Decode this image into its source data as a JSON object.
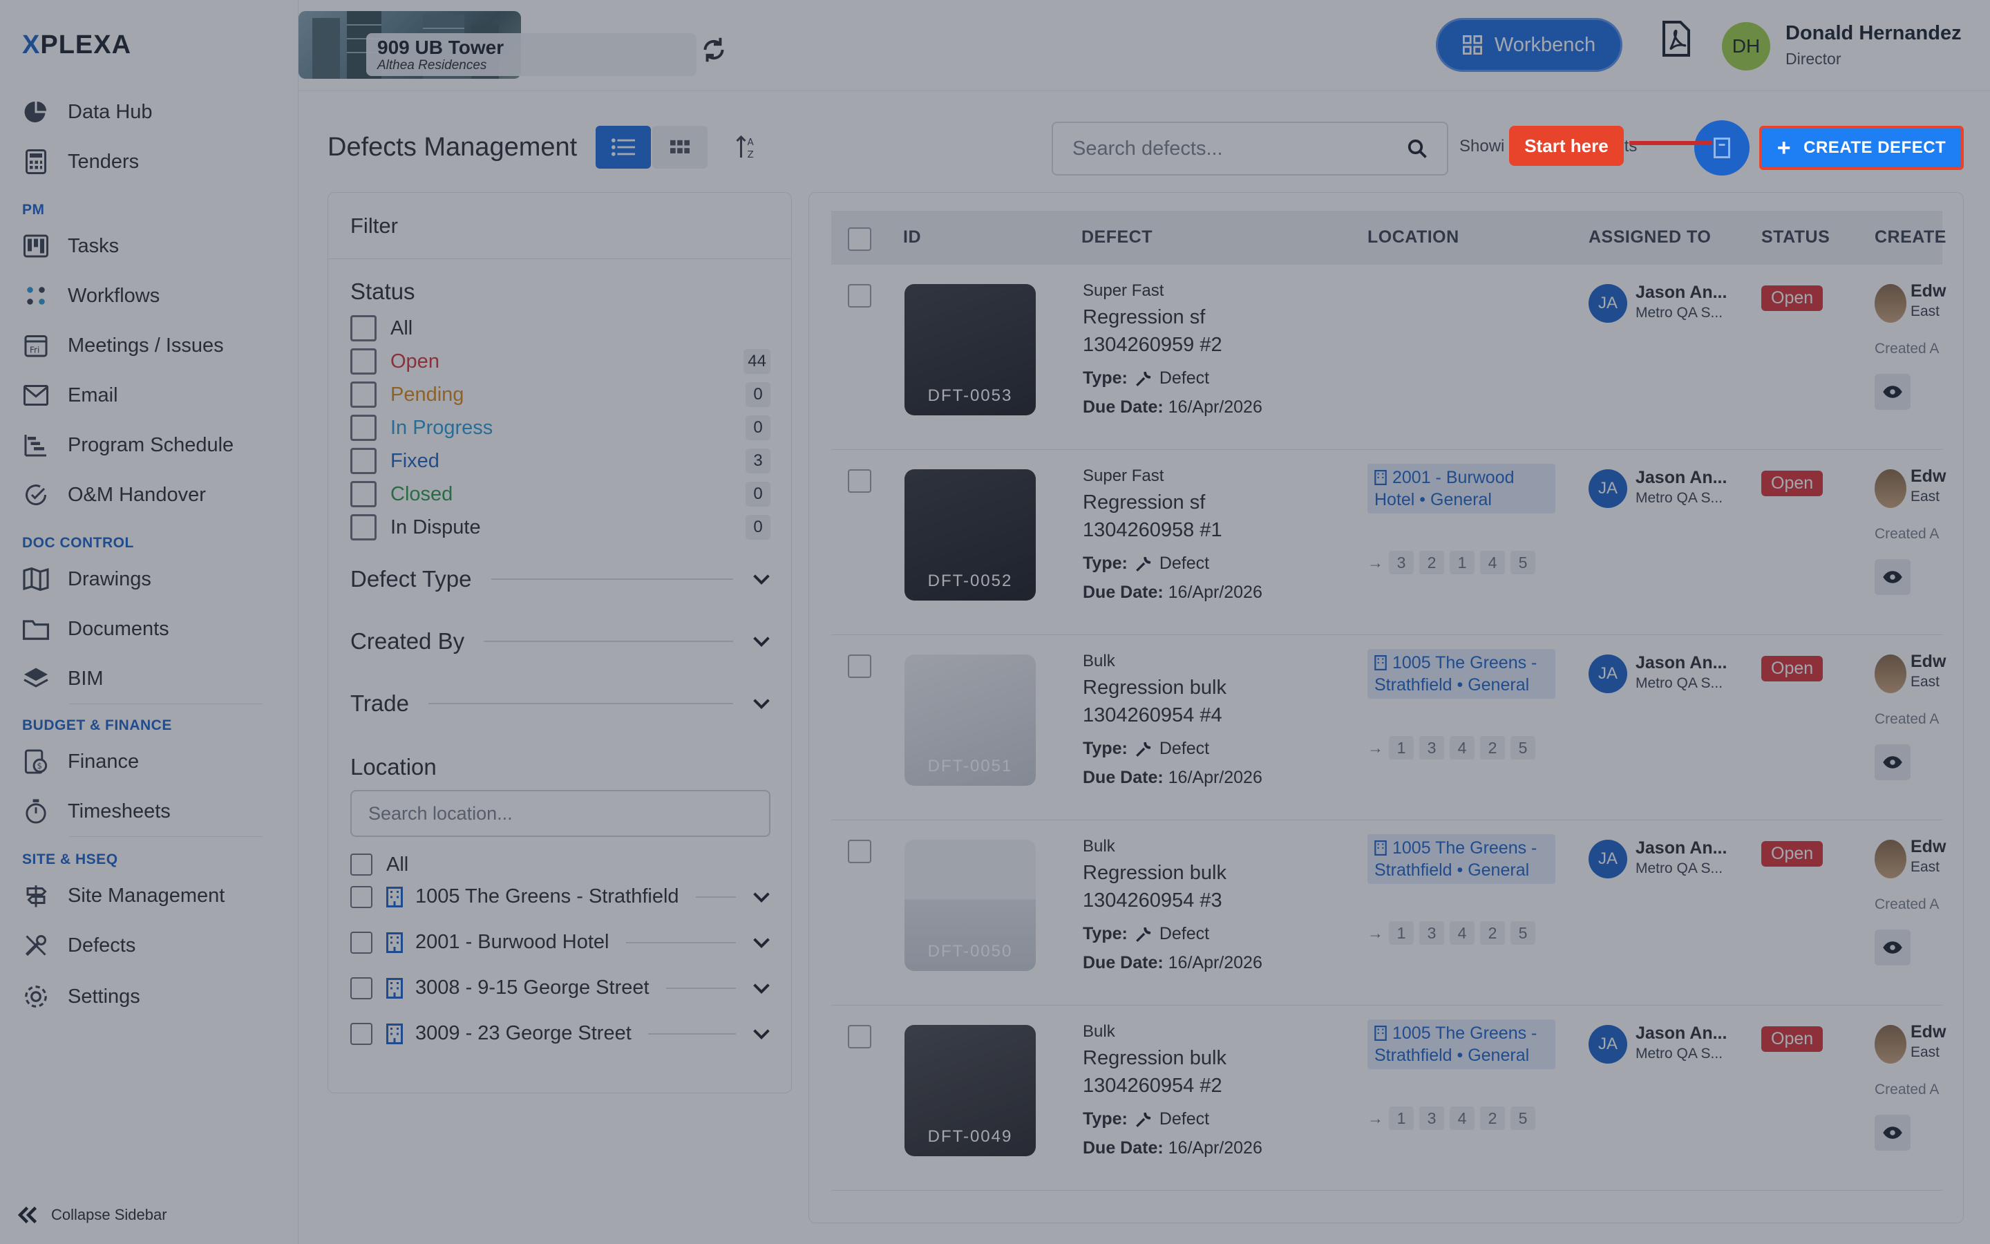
{
  "sidebar": {
    "logo_prefix": "X",
    "logo_text": "PLEXA",
    "items_top": [
      {
        "label": "Data Hub",
        "icon": "pie-chart-icon"
      },
      {
        "label": "Tenders",
        "icon": "calculator-icon"
      }
    ],
    "section_pm": "PM",
    "items_pm": [
      {
        "label": "Tasks",
        "icon": "kanban-icon"
      },
      {
        "label": "Workflows",
        "icon": "workflow-icon"
      },
      {
        "label": "Meetings / Issues",
        "icon": "calendar-icon"
      },
      {
        "label": "Email",
        "icon": "envelope-icon"
      },
      {
        "label": "Program Schedule",
        "icon": "gantt-icon"
      },
      {
        "label": "O&M Handover",
        "icon": "check-circle-icon"
      }
    ],
    "section_doc": "DOC CONTROL",
    "items_doc": [
      {
        "label": "Drawings",
        "icon": "map-icon"
      },
      {
        "label": "Documents",
        "icon": "folder-icon"
      },
      {
        "label": "BIM",
        "icon": "layers-icon"
      }
    ],
    "section_budget": "BUDGET & FINANCE",
    "items_budget": [
      {
        "label": "Finance",
        "icon": "finance-icon"
      },
      {
        "label": "Timesheets",
        "icon": "stopwatch-icon"
      }
    ],
    "section_site": "SITE & HSEQ",
    "items_site": [
      {
        "label": "Site Management",
        "icon": "signpost-icon"
      },
      {
        "label": "Defects",
        "icon": "tools-icon"
      },
      {
        "label": "Settings",
        "icon": "gear-icon"
      }
    ],
    "collapse_label": "Collapse Sidebar"
  },
  "topbar": {
    "project_name": "909 UB Tower",
    "project_sub": "Althea Residences",
    "workbench_label": "Workbench",
    "user_initials": "DH",
    "user_name": "Donald Hernandez",
    "user_role": "Director"
  },
  "main": {
    "title": "Defects Management",
    "search_placeholder": "Search defects...",
    "showing_prefix": "Showi",
    "showing_suffix": "efects",
    "start_here": "Start here",
    "create_label": "CREATE DEFECT"
  },
  "filter": {
    "title": "Filter",
    "status_title": "Status",
    "statuses": [
      {
        "label": "All",
        "count": "",
        "color": "#2b2f36"
      },
      {
        "label": "Open",
        "count": "44",
        "color": "#d9343a"
      },
      {
        "label": "Pending",
        "count": "0",
        "color": "#d98a1e"
      },
      {
        "label": "In Progress",
        "count": "0",
        "color": "#2e9bd6"
      },
      {
        "label": "Fixed",
        "count": "3",
        "color": "#1e64c8"
      },
      {
        "label": "Closed",
        "count": "0",
        "color": "#2f9a4c"
      },
      {
        "label": "In Dispute",
        "count": "0",
        "color": "#2b2f36"
      }
    ],
    "defect_type": "Defect Type",
    "created_by": "Created By",
    "trade": "Trade",
    "location_title": "Location",
    "location_placeholder": "Search location...",
    "location_all": "All",
    "locations": [
      "1005 The Greens - Strathfield",
      "2001 - Burwood Hotel",
      "3008 - 9-15 George Street",
      "3009 - 23 George Street"
    ]
  },
  "table": {
    "headers": {
      "id": "ID",
      "defect": "DEFECT",
      "location": "LOCATION",
      "assigned": "ASSIGNED TO",
      "status": "STATUS",
      "created": "CREATE"
    },
    "type_label": "Type:",
    "due_label": "Due Date:",
    "rows": [
      {
        "id": "DFT-0053",
        "category": "Super Fast",
        "title": "Regression sf 1304260959 #2",
        "type": "Defect",
        "due": "16/Apr/2026",
        "location": "",
        "steps": [],
        "assignee": "Jason An...",
        "assignee_org": "Metro QA S...",
        "status": "Open",
        "creator": "Edw",
        "creator_org": "East",
        "created": "Created A"
      },
      {
        "id": "DFT-0052",
        "category": "Super Fast",
        "title": "Regression sf 1304260958 #1",
        "type": "Defect",
        "due": "16/Apr/2026",
        "location": "2001 - Burwood Hotel • General",
        "steps": [
          "3",
          "2",
          "1",
          "4",
          "5"
        ],
        "assignee": "Jason An...",
        "assignee_org": "Metro QA S...",
        "status": "Open",
        "creator": "Edw",
        "creator_org": "East",
        "created": "Created A"
      },
      {
        "id": "DFT-0051",
        "category": "Bulk",
        "title": "Regression bulk 1304260954 #4",
        "type": "Defect",
        "due": "16/Apr/2026",
        "location": "1005 The Greens - Strathfield • General",
        "steps": [
          "1",
          "3",
          "4",
          "2",
          "5"
        ],
        "assignee": "Jason An...",
        "assignee_org": "Metro QA S...",
        "status": "Open",
        "creator": "Edw",
        "creator_org": "East",
        "created": "Created A"
      },
      {
        "id": "DFT-0050",
        "category": "Bulk",
        "title": "Regression bulk 1304260954 #3",
        "type": "Defect",
        "due": "16/Apr/2026",
        "location": "1005 The Greens - Strathfield • General",
        "steps": [
          "1",
          "3",
          "4",
          "2",
          "5"
        ],
        "assignee": "Jason An...",
        "assignee_org": "Metro QA S...",
        "status": "Open",
        "creator": "Edw",
        "creator_org": "East",
        "created": "Created A"
      },
      {
        "id": "DFT-0049",
        "category": "Bulk",
        "title": "Regression bulk 1304260954 #2",
        "type": "Defect",
        "due": "16/Apr/2026",
        "location": "1005 The Greens - Strathfield • General",
        "steps": [
          "1",
          "3",
          "4",
          "2",
          "5"
        ],
        "assignee": "Jason An...",
        "assignee_org": "Metro QA S...",
        "status": "Open",
        "creator": "Edw",
        "creator_org": "East",
        "created": "Created A"
      }
    ],
    "assignee_initials": "JA"
  },
  "colors": {
    "accent": "#1e6fe0",
    "danger": "#d9343a",
    "highlight": "#e8442c"
  }
}
